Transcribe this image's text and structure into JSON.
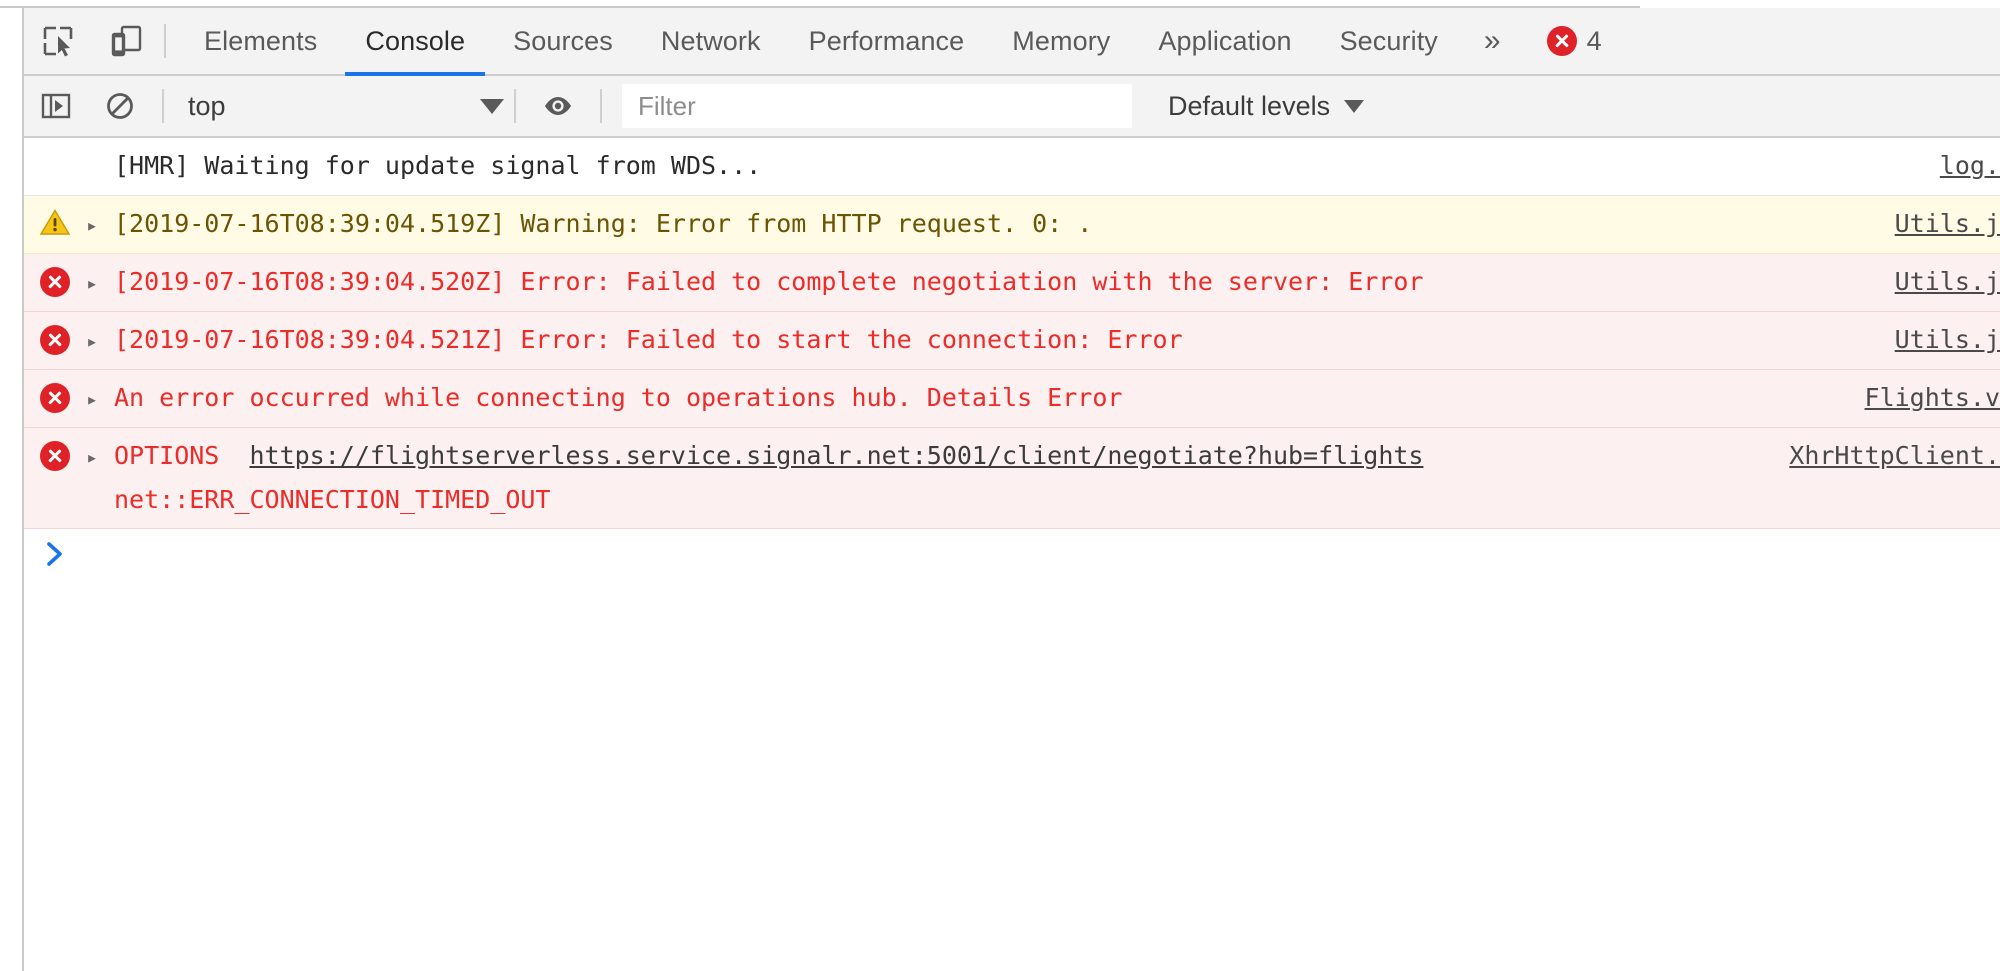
{
  "tabbar": {
    "inspect_icon": "inspect-element-icon",
    "device_icon": "device-toolbar-icon",
    "tabs": [
      {
        "label": "Elements",
        "active": false
      },
      {
        "label": "Console",
        "active": true
      },
      {
        "label": "Sources",
        "active": false
      },
      {
        "label": "Network",
        "active": false
      },
      {
        "label": "Performance",
        "active": false
      },
      {
        "label": "Memory",
        "active": false
      },
      {
        "label": "Application",
        "active": false
      },
      {
        "label": "Security",
        "active": false
      }
    ],
    "more_label": "»",
    "error_count": "4",
    "error_icon": "error-circle-icon",
    "accent_color": "#1a73e8"
  },
  "toolbar": {
    "sidebar_icon": "console-sidebar-icon",
    "clear_icon": "clear-console-icon",
    "context": {
      "value": "top",
      "caret_icon": "chevron-down-icon"
    },
    "eye_icon": "live-expression-icon",
    "filter": {
      "value": "",
      "placeholder": "Filter"
    },
    "levels": {
      "label": "Default levels",
      "caret_icon": "chevron-down-icon"
    }
  },
  "console": {
    "messages": [
      {
        "level": "log",
        "icon": "",
        "disclosure": "▸",
        "lines": [
          "[HMR] Waiting for update signal from WDS..."
        ],
        "source": "log."
      },
      {
        "level": "warning",
        "icon": "warning-triangle-icon",
        "disclosure": "▸",
        "lines": [
          "[2019-07-16T08:39:04.519Z] Warning: Error from HTTP request. 0: ."
        ],
        "source": "Utils.j"
      },
      {
        "level": "error",
        "icon": "error-circle-icon",
        "disclosure": "▸",
        "lines": [
          "[2019-07-16T08:39:04.520Z] Error: Failed to complete negotiation with the server: Error"
        ],
        "source": "Utils.j"
      },
      {
        "level": "error",
        "icon": "error-circle-icon",
        "disclosure": "▸",
        "lines": [
          "[2019-07-16T08:39:04.521Z] Error: Failed to start the connection: Error"
        ],
        "source": "Utils.j"
      },
      {
        "level": "error",
        "icon": "error-circle-icon",
        "disclosure": "▸",
        "lines": [
          "An error occurred while connecting to operations hub. Details Error"
        ],
        "source": "Flights.v"
      },
      {
        "level": "error",
        "icon": "error-circle-icon",
        "disclosure": "▸",
        "method": "OPTIONS",
        "url": "https://flightserverless.service.signalr.net:5001/client/negotiate?hub=flights",
        "lines": [
          "net::ERR_CONNECTION_TIMED_OUT"
        ],
        "source": "XhrHttpClient."
      }
    ],
    "prompt": {
      "caret_icon": "prompt-chevron-icon",
      "value": ""
    }
  }
}
